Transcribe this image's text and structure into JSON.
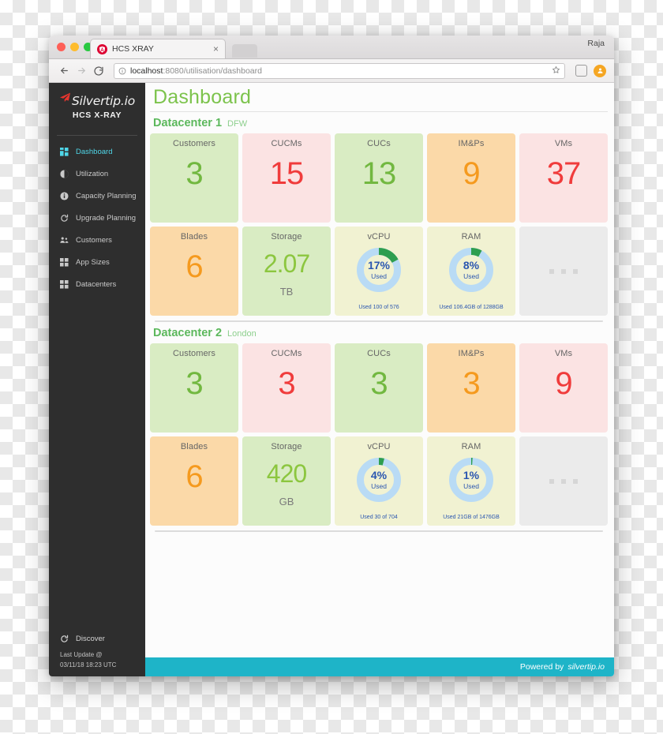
{
  "browser": {
    "tab_title": "HCS XRAY",
    "tab_close": "×",
    "url_host": "localhost",
    "url_path": ":8080/utilisation/dashboard",
    "user": "Raja"
  },
  "sidebar": {
    "logo_text": "Silvertip.io",
    "logo_sub": "HCS X-RAY",
    "items": [
      {
        "label": "Dashboard",
        "icon": "grid-icon",
        "active": true
      },
      {
        "label": "Utilization",
        "icon": "pie-chart-icon",
        "active": false
      },
      {
        "label": "Capacity Planning",
        "icon": "info-icon",
        "active": false
      },
      {
        "label": "Upgrade Planning",
        "icon": "refresh-icon",
        "active": false
      },
      {
        "label": "Customers",
        "icon": "users-icon",
        "active": false
      },
      {
        "label": "App Sizes",
        "icon": "grid-icon",
        "active": false
      },
      {
        "label": "Datacenters",
        "icon": "grid-icon",
        "active": false
      }
    ],
    "discover_label": "Discover",
    "last_update_label": "Last Update @",
    "last_update_value": "03/11/18 18:23 UTC"
  },
  "main": {
    "page_title": "Dashboard",
    "datacenters": [
      {
        "name": "Datacenter 1",
        "location": "DFW",
        "row1": [
          {
            "label": "Customers",
            "value": "3",
            "bg": "#d9ecc3",
            "color": "#72b840"
          },
          {
            "label": "CUCMs",
            "value": "15",
            "bg": "#fbe3e3",
            "color": "#f03c3c"
          },
          {
            "label": "CUCs",
            "value": "13",
            "bg": "#d9ecc3",
            "color": "#72b840"
          },
          {
            "label": "IM&Ps",
            "value": "9",
            "bg": "#fbd9a8",
            "color": "#f59a1e"
          },
          {
            "label": "VMs",
            "value": "37",
            "bg": "#fbe3e3",
            "color": "#f03c3c"
          }
        ],
        "row2": {
          "blades": {
            "label": "Blades",
            "value": "6",
            "bg": "#fbd9a8",
            "color": "#f59a1e"
          },
          "storage": {
            "label": "Storage",
            "value": "2.07",
            "unit": "TB",
            "bg": "#d9ecc3",
            "color": "#8cc63f"
          },
          "vcpu": {
            "label": "vCPU",
            "percent": 17,
            "percent_text": "17%",
            "used_text": "Used",
            "caption": "Used 100 of 576",
            "bg": "#f1f2d2"
          },
          "ram": {
            "label": "RAM",
            "percent": 8,
            "percent_text": "8%",
            "used_text": "Used",
            "caption": "Used 106.4GB of 1288GB",
            "bg": "#f1f2d2"
          },
          "placeholder": {
            "dots": 3
          }
        }
      },
      {
        "name": "Datacenter 2",
        "location": "London",
        "row1": [
          {
            "label": "Customers",
            "value": "3",
            "bg": "#d9ecc3",
            "color": "#72b840"
          },
          {
            "label": "CUCMs",
            "value": "3",
            "bg": "#fbe3e3",
            "color": "#f03c3c"
          },
          {
            "label": "CUCs",
            "value": "3",
            "bg": "#d9ecc3",
            "color": "#72b840"
          },
          {
            "label": "IM&Ps",
            "value": "3",
            "bg": "#fbd9a8",
            "color": "#f59a1e"
          },
          {
            "label": "VMs",
            "value": "9",
            "bg": "#fbe3e3",
            "color": "#f03c3c"
          }
        ],
        "row2": {
          "blades": {
            "label": "Blades",
            "value": "6",
            "bg": "#fbd9a8",
            "color": "#f59a1e"
          },
          "storage": {
            "label": "Storage",
            "value": "420",
            "unit": "GB",
            "bg": "#d9ecc3",
            "color": "#8cc63f"
          },
          "vcpu": {
            "label": "vCPU",
            "percent": 4,
            "percent_text": "4%",
            "used_text": "Used",
            "caption": "Used 30 of 704",
            "bg": "#f1f2d2"
          },
          "ram": {
            "label": "RAM",
            "percent": 1,
            "percent_text": "1%",
            "used_text": "Used",
            "caption": "Used 21GB of 1476GB",
            "bg": "#f1f2d2"
          },
          "placeholder": {
            "dots": 3
          }
        }
      }
    ]
  },
  "footer": {
    "powered_by": "Powered by",
    "brand": "silvertip.io"
  },
  "colors": {
    "accent_teal": "#1eb4c8",
    "sidebar_bg": "#2e2e2e",
    "active_nav": "#4fd6e8",
    "title_green": "#7cc34c",
    "donut_track": "#b9dbf5",
    "donut_arc": "#2e9e4f",
    "donut_text": "#2a56b0"
  },
  "chart_data": [
    {
      "type": "pie",
      "title": "vCPU",
      "subtitle": "Datacenter 1 DFW",
      "categories": [
        "Used",
        "Free"
      ],
      "values": [
        17,
        83
      ],
      "annotation": "Used 100 of 576",
      "center_label": "17% Used"
    },
    {
      "type": "pie",
      "title": "RAM",
      "subtitle": "Datacenter 1 DFW",
      "categories": [
        "Used",
        "Free"
      ],
      "values": [
        8,
        92
      ],
      "annotation": "Used 106.4GB of 1288GB",
      "center_label": "8% Used"
    },
    {
      "type": "pie",
      "title": "vCPU",
      "subtitle": "Datacenter 2 London",
      "categories": [
        "Used",
        "Free"
      ],
      "values": [
        4,
        96
      ],
      "annotation": "Used 30 of 704",
      "center_label": "4% Used"
    },
    {
      "type": "pie",
      "title": "RAM",
      "subtitle": "Datacenter 2 London",
      "categories": [
        "Used",
        "Free"
      ],
      "values": [
        1,
        99
      ],
      "annotation": "Used 21GB of 1476GB",
      "center_label": "1% Used"
    }
  ]
}
